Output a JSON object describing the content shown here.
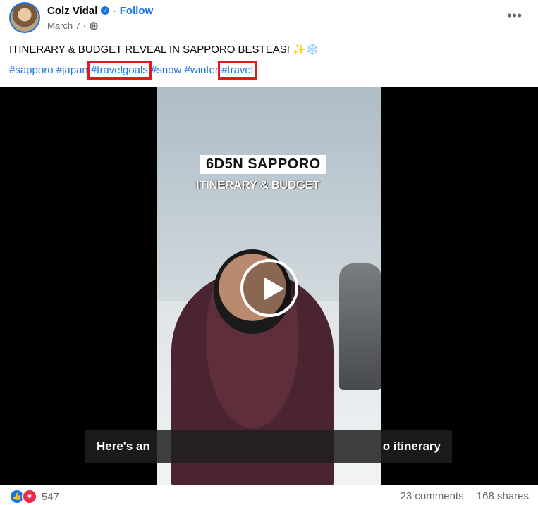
{
  "post": {
    "author": "Colz Vidal",
    "separator": "·",
    "follow_label": "Follow",
    "date": "March 7 ·",
    "more_icon": "more-horizontal-icon",
    "caption": "ITINERARY & BUDGET REVEAL IN SAPPORO BESTEAS! ✨❄️",
    "hashtags": [
      "#sapporo",
      "#japan",
      "#travelgoals",
      "#snow",
      "#winter",
      "#travel"
    ],
    "highlighted_hashtags": [
      "#travelgoals",
      "#travel"
    ],
    "highlight_color": "#e11b1b"
  },
  "video": {
    "title": "6D5N SAPPORO",
    "subtitle": "ITINERARY & BUDGET",
    "caption_left": "Here's an",
    "caption_right": "o itinerary",
    "play_icon": "play-icon"
  },
  "footer": {
    "reaction_count": "547",
    "comments": "23 comments",
    "shares": "168 shares"
  },
  "colors": {
    "accent": "#1b74e4",
    "love": "#f0284a"
  }
}
